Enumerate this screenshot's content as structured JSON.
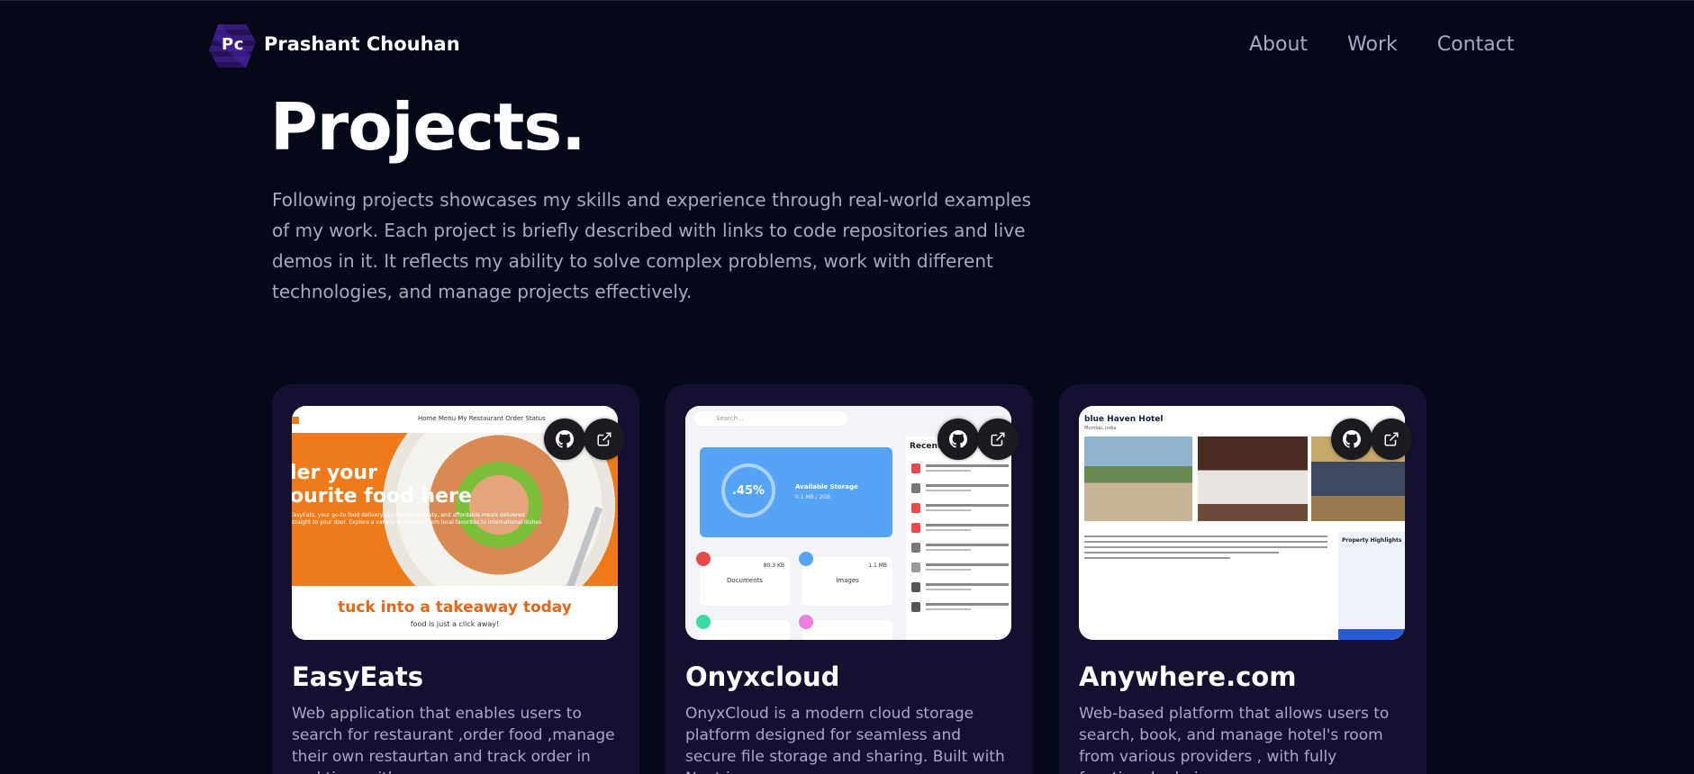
{
  "nav": {
    "logo_text": "Pc",
    "brand_name": "Prashant Chouhan",
    "links": [
      "About",
      "Work",
      "Contact"
    ]
  },
  "hero": {
    "title": "Projects.",
    "intro": "Following projects showcases my skills and experience through real-world examples of my work. Each project is briefly described with links to code repositories and live demos in it. It reflects my ability to solve complex problems, work with different technologies, and manage projects effectively."
  },
  "projects": [
    {
      "title": "EasyEats",
      "description": "Web application that enables users to search for restaurant ,order food ,manage their own restaurtan and track order in real time with",
      "thumbnail": {
        "nav": "Home   Menu   My Restaurant   Order Status",
        "headline_1": "ler your",
        "headline_2": "ourite food here",
        "blurb": "EasyEats, your go-to food delivery app for quick, tasty, and affordable meals delivered straight to your door. Explore a variety of cuisines from local favorites to international dishes",
        "tagline": "tuck into a takeaway today",
        "subline": "food is just a click away!"
      }
    },
    {
      "title": "Onyxcloud",
      "description": "OnyxCloud is a modern cloud storage platform designed for seamless and secure file storage and sharing. Built with Next.js,",
      "thumbnail": {
        "search_placeholder": "Search...",
        "percent": ".45%",
        "available": "Available Storage",
        "gb": "0.1 MB / 2GB",
        "recent": "Recent files uploaded",
        "documents": "Documents",
        "images": "Images",
        "doc_size": "80.3 KB",
        "img_size": "1.1 MB"
      }
    },
    {
      "title": "Anywhere.com",
      "description": "Web-based platform that allows users to search, book, and manage hotel's room from various providers , with fully functional admin",
      "thumbnail": {
        "hotel": "blue Haven Hotel",
        "location": "Mumbai, India",
        "highlights": "Property Highlights"
      }
    }
  ],
  "icons": {
    "github": "github-icon",
    "external": "external-link-icon"
  },
  "colors": {
    "background": "#050816",
    "card": "#151030",
    "secondary_text": "#aaa6c3"
  }
}
